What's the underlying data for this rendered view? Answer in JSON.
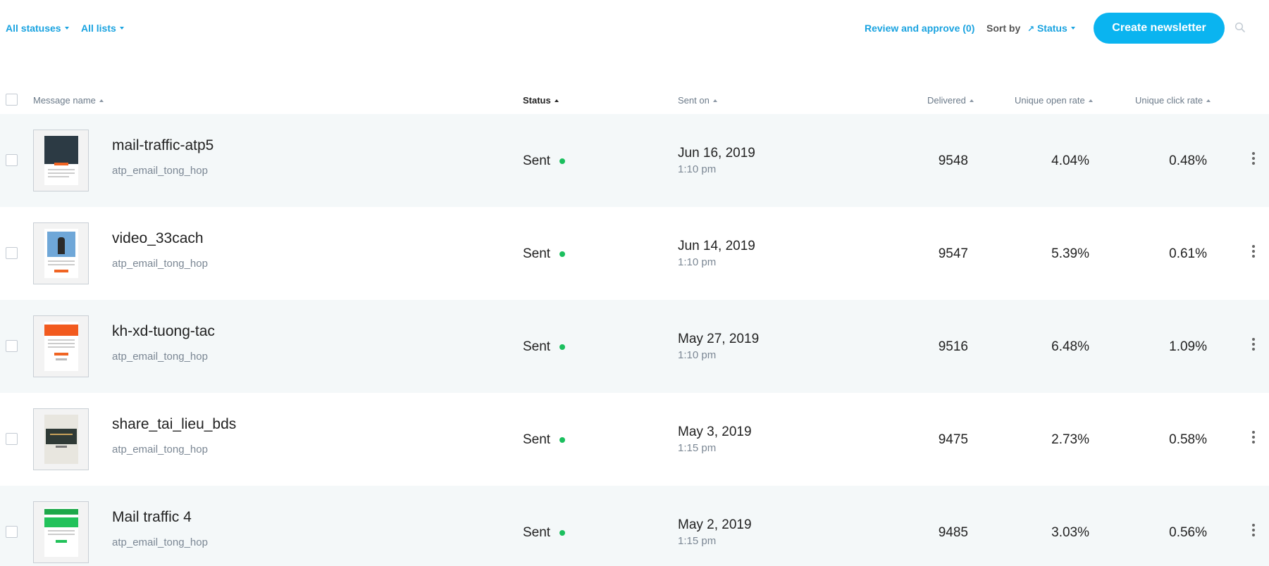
{
  "toolbar": {
    "filter_status": "All statuses",
    "filter_lists": "All lists",
    "review_link": "Review and approve (0)",
    "sort_by_label": "Sort by",
    "sort_value": "Status",
    "create_button": "Create newsletter"
  },
  "table": {
    "headers": {
      "message_name": "Message name",
      "status": "Status",
      "sent_on": "Sent on",
      "delivered": "Delivered",
      "open_rate": "Unique open rate",
      "click_rate": "Unique click rate"
    },
    "rows": [
      {
        "name": "mail-traffic-atp5",
        "list": "atp_email_tong_hop",
        "status": "Sent",
        "date": "Jun 16, 2019",
        "time": "1:10 pm",
        "delivered": "9548",
        "open_rate": "4.04%",
        "click_rate": "0.48%"
      },
      {
        "name": "video_33cach",
        "list": "atp_email_tong_hop",
        "status": "Sent",
        "date": "Jun 14, 2019",
        "time": "1:10 pm",
        "delivered": "9547",
        "open_rate": "5.39%",
        "click_rate": "0.61%"
      },
      {
        "name": "kh-xd-tuong-tac",
        "list": "atp_email_tong_hop",
        "status": "Sent",
        "date": "May 27, 2019",
        "time": "1:10 pm",
        "delivered": "9516",
        "open_rate": "6.48%",
        "click_rate": "1.09%"
      },
      {
        "name": "share_tai_lieu_bds",
        "list": "atp_email_tong_hop",
        "status": "Sent",
        "date": "May 3, 2019",
        "time": "1:15 pm",
        "delivered": "9475",
        "open_rate": "2.73%",
        "click_rate": "0.58%"
      },
      {
        "name": "Mail traffic 4",
        "list": "atp_email_tong_hop",
        "status": "Sent",
        "date": "May 2, 2019",
        "time": "1:15 pm",
        "delivered": "9485",
        "open_rate": "3.03%",
        "click_rate": "0.56%"
      }
    ]
  },
  "colors": {
    "accent": "#0ab4f0",
    "link": "#1aa3e0",
    "status_sent": "#1bbf5e",
    "row_alt": "#f4f8f9"
  }
}
